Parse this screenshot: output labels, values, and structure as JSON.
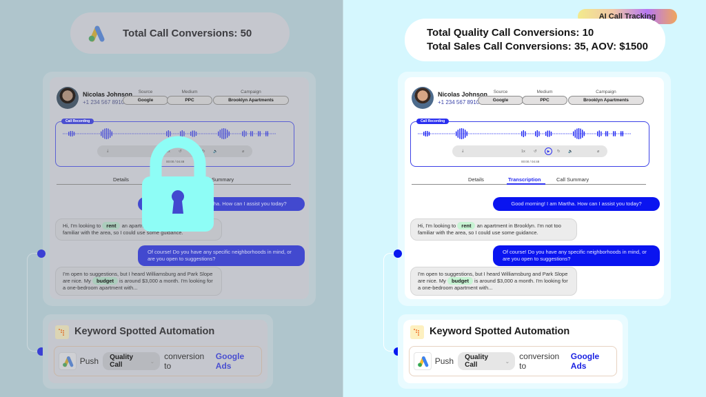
{
  "left_panel": {
    "state": "locked",
    "summary": {
      "text": "Total Call Conversions: 50",
      "icon": "google-ads-icon"
    },
    "overlay_icon": "lock-icon",
    "overlay_color": "#8efdf6"
  },
  "right_panel": {
    "badge": "AI Call Tracking",
    "summary": {
      "line1": "Total Quality Call Conversions: 10",
      "line2": "Total Sales Call Conversions: 35, AOV: $1500"
    }
  },
  "call": {
    "contact": {
      "name": "Nicolas Johnson",
      "phone": "+1 234 567 8910"
    },
    "attributes": [
      {
        "label": "Source",
        "value": "Google"
      },
      {
        "label": "Medium",
        "value": "PPC"
      },
      {
        "label": "Campaign",
        "value": "Brooklyn Apartments"
      }
    ],
    "recording": {
      "tag": "Call Recording",
      "speed": "1x",
      "time": "00:00 / 04:48",
      "icons": [
        "download-icon",
        "rewind-icon",
        "play-icon",
        "forward-icon",
        "volume-icon",
        "link-icon"
      ]
    },
    "tabs": [
      {
        "label": "Details",
        "active": false
      },
      {
        "label": "Transcription",
        "active": true
      },
      {
        "label": "Call Summary",
        "active": false
      }
    ],
    "transcript": [
      {
        "speaker": "agent",
        "text": "Good morning! I am Martha. How can I assist you today?"
      },
      {
        "speaker": "caller",
        "pre": "Hi, I'm looking to",
        "keyword": "rent",
        "post": "an apartment in Brooklyn. I'm not too familiar with the area, so I could use some guidance."
      },
      {
        "speaker": "agent",
        "text": "Of course! Do you have any specific neighborhoods in mind, or are you open to suggestions?"
      },
      {
        "speaker": "caller",
        "pre": "I'm open to suggestions, but I heard Williamsburg and Park Slope are nice. My",
        "keyword": "budget",
        "post": "is around $3,000 a month. I'm looking for a one-bedroom apartment with..."
      }
    ]
  },
  "automation": {
    "title": "Keyword Spotted Automation",
    "push": "Push",
    "conversion": "Quality Call",
    "middle": "conversion to",
    "destination": "Google Ads"
  },
  "colors": {
    "accent": "#0a14f0",
    "keyword_highlight": "#c7f3d3",
    "left_bg": "#afc5cc",
    "right_bg": "#d5f7fe"
  }
}
